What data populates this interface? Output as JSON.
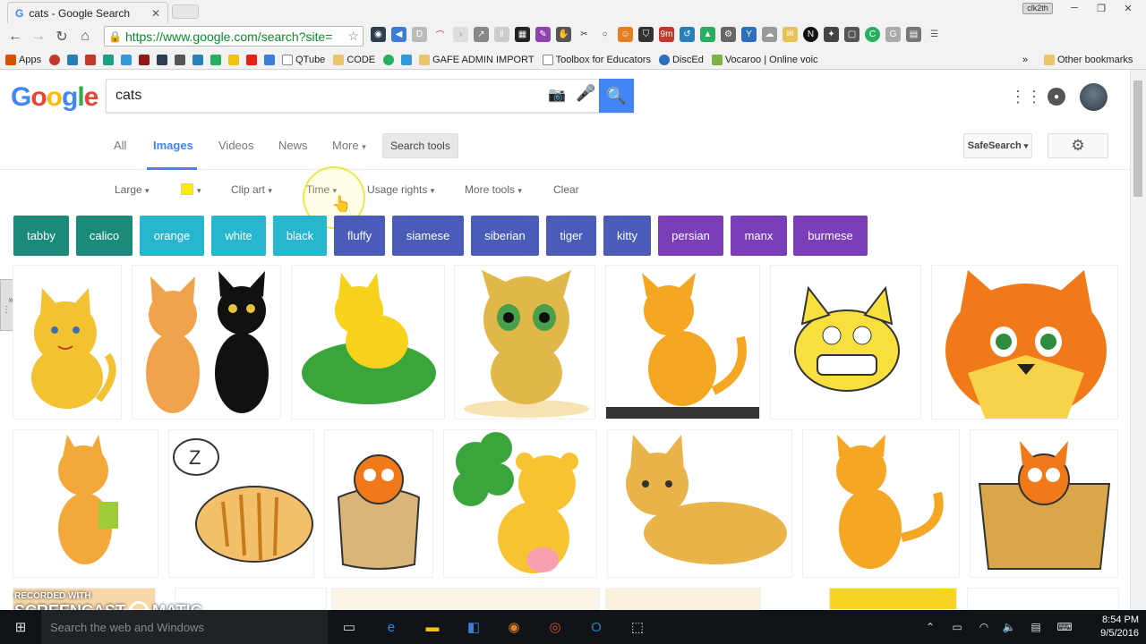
{
  "browser": {
    "tab_title": "cats - Google Search",
    "user_chip": "clk2th",
    "url": "https://www.google.com/search?site=",
    "bookmarks": [
      "Apps",
      "QTube",
      "CODE",
      "GAFE ADMIN IMPORT",
      "Toolbox for Educators",
      "DiscEd",
      "Vocaroo | Online voic"
    ],
    "other_bookmarks": "Other bookmarks"
  },
  "google": {
    "logo": "Google",
    "query": "cats",
    "tabs": [
      "All",
      "Images",
      "Videos",
      "News",
      "More"
    ],
    "active_tab": "Images",
    "search_tools": "Search tools",
    "safesearch": "SafeSearch"
  },
  "tools": {
    "size": "Large",
    "color_swatch": "#ffeb00",
    "type": "Clip art",
    "time": "Time",
    "usage": "Usage rights",
    "more": "More tools",
    "clear": "Clear"
  },
  "chips": [
    {
      "label": "tabby",
      "color": "#1a8a7a"
    },
    {
      "label": "calico",
      "color": "#1a8a7a"
    },
    {
      "label": "orange",
      "color": "#26b7cf"
    },
    {
      "label": "white",
      "color": "#26b7cf"
    },
    {
      "label": "black",
      "color": "#26b7cf"
    },
    {
      "label": "fluffy",
      "color": "#4a5bb8"
    },
    {
      "label": "siamese",
      "color": "#4a5bb8"
    },
    {
      "label": "siberian",
      "color": "#4a5bb8"
    },
    {
      "label": "tiger",
      "color": "#4a5bb8"
    },
    {
      "label": "kitty",
      "color": "#4a5bb8"
    },
    {
      "label": "persian",
      "color": "#7a3fb8"
    },
    {
      "label": "manx",
      "color": "#7a3fb8"
    },
    {
      "label": "burmese",
      "color": "#7a3fb8"
    }
  ],
  "taskbar": {
    "search_placeholder": "Search the web and Windows",
    "time": "8:54 PM",
    "date": "9/5/2016"
  },
  "watermark": {
    "line1": "RECORDED WITH",
    "line2": "SCREENCAST",
    "line3": "MATIC"
  }
}
